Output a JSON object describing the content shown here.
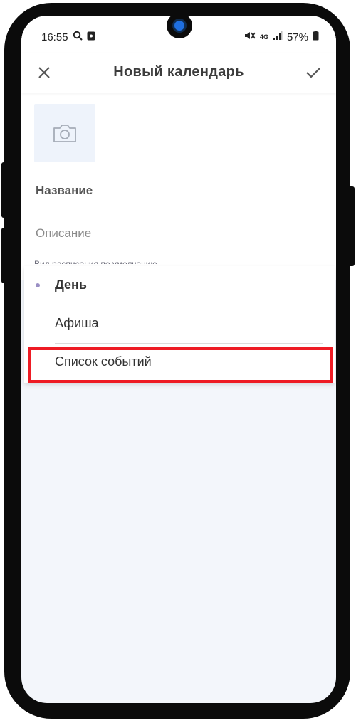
{
  "status_bar": {
    "time": "16:55",
    "network": "4G",
    "battery": "57%",
    "icons": [
      "search-icon",
      "notification-icon",
      "mute-icon",
      "signal-icon",
      "battery-icon"
    ]
  },
  "header": {
    "title": "Новый календарь",
    "close_icon": "close-icon",
    "confirm_icon": "check-icon"
  },
  "form": {
    "photo_icon": "camera-icon",
    "name_label": "Название",
    "description_placeholder": "Описание",
    "default_view_label": "Вид расписания по умолчанию"
  },
  "dropdown": {
    "options": [
      {
        "label": "День",
        "selected": true
      },
      {
        "label": "Афиша",
        "selected": false
      },
      {
        "label": "Список событий",
        "selected": false
      }
    ]
  },
  "colors": {
    "accent_dot": "#9a8fc4",
    "highlight": "#ee1b24",
    "screen_background": "#f3f6fb"
  }
}
